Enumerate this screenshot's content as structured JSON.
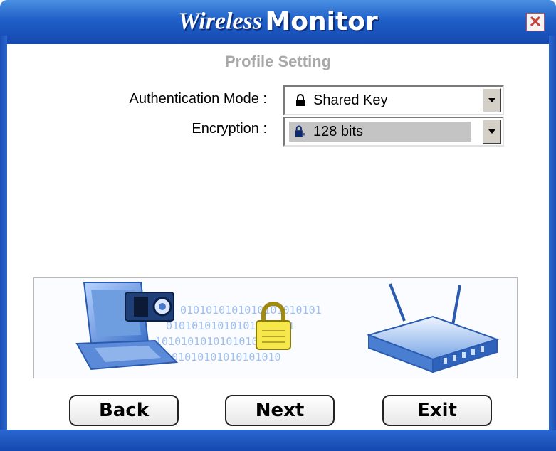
{
  "window": {
    "title_part1": "Wireless",
    "title_part2": "Monitor",
    "close_symbol": "✕"
  },
  "page": {
    "subtitle": "Profile Setting"
  },
  "form": {
    "authentication": {
      "label": "Authentication Mode :",
      "value": "Shared Key",
      "icon": "lock-icon"
    },
    "encryption": {
      "label": "Encryption :",
      "value": "128 bits",
      "icon": "encryption-lock-icon"
    }
  },
  "banner": {
    "binary_lines": [
      "0101010101010101010101",
      "01010101010101010101",
      "1010101010101010101",
      "0101010101010101010"
    ],
    "icons": [
      "laptop-icon",
      "camera-icon",
      "padlock-icon",
      "router-icon"
    ]
  },
  "buttons": {
    "back": "Back",
    "next": "Next",
    "exit": "Exit"
  },
  "colors": {
    "frame_blue": "#1f5fc8",
    "subtitle_gray": "#a8a8a8",
    "selection_gray": "#c4c4c4"
  }
}
